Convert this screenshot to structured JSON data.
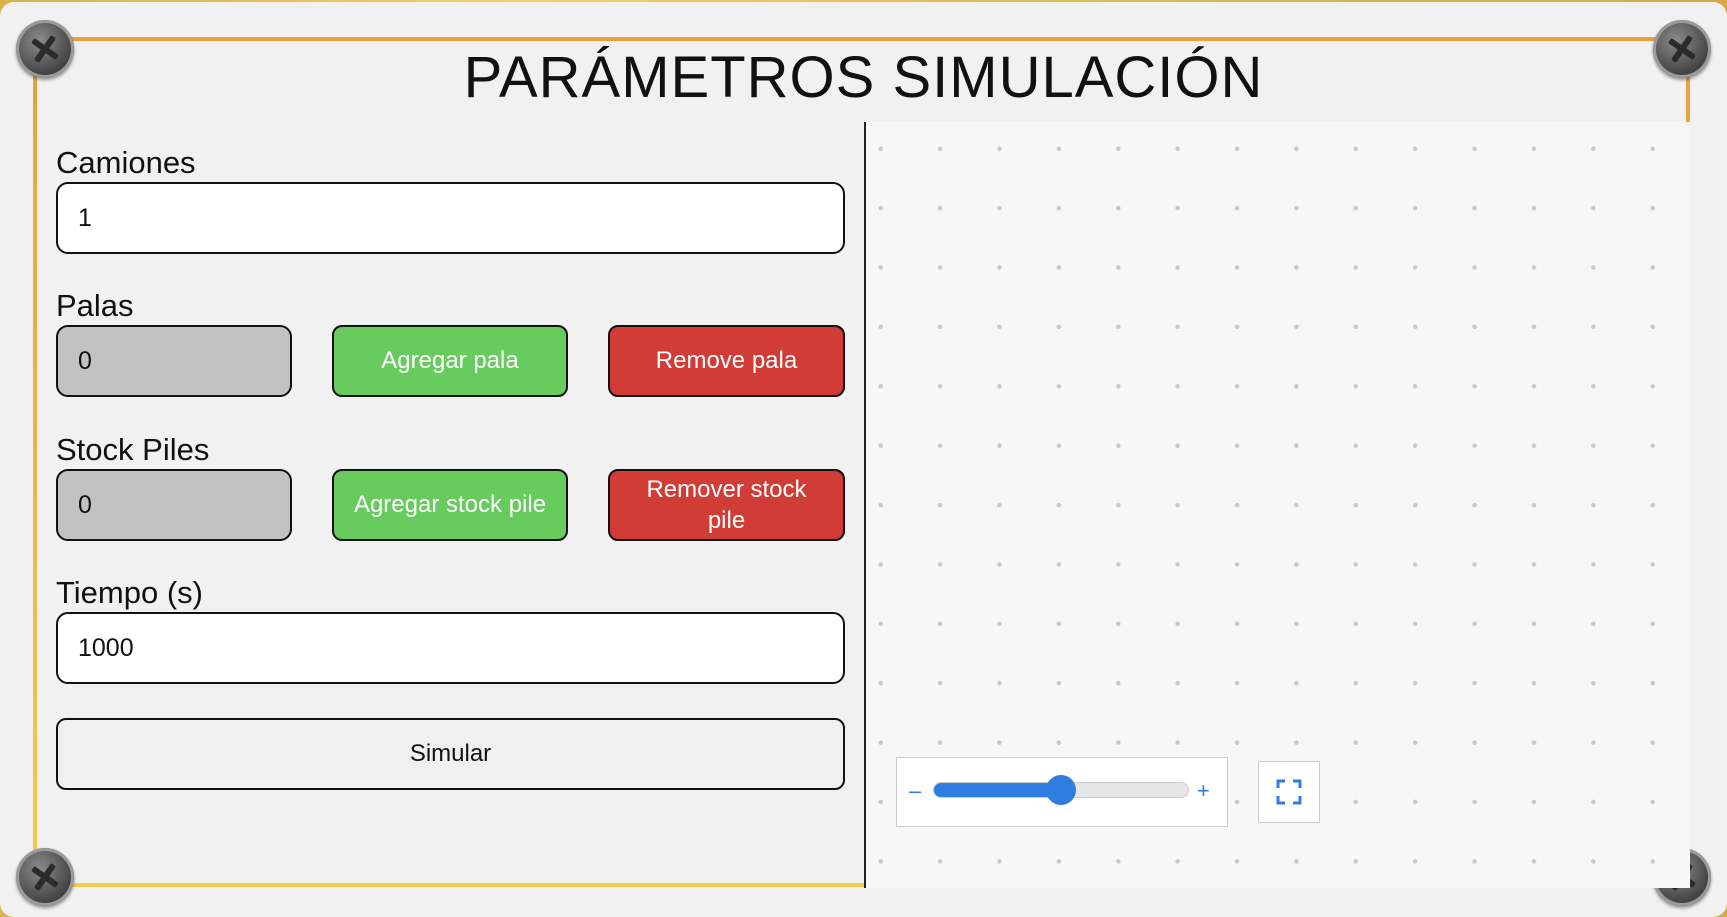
{
  "title": "PARÁMETROS SIMULACIÓN",
  "camiones": {
    "label": "Camiones",
    "value": "1"
  },
  "palas": {
    "label": "Palas",
    "value": "0",
    "add_label": "Agregar pala",
    "remove_label": "Remove pala"
  },
  "stock_piles": {
    "label": "Stock Piles",
    "value": "0",
    "add_label": "Agregar stock pile",
    "remove_label": "Remover stock pile"
  },
  "tiempo": {
    "label": "Tiempo (s)",
    "value": "1000"
  },
  "simulate_label": "Simular",
  "canvas_controls": {
    "zoom_minus": "–",
    "zoom_plus": "+",
    "zoom_level": 0.5,
    "accent": "#2f7de0",
    "fullscreen_icon": "fullscreen-icon"
  },
  "colors": {
    "add": "#68cb5e",
    "remove": "#d13c36",
    "frame": "#e8a33c"
  }
}
